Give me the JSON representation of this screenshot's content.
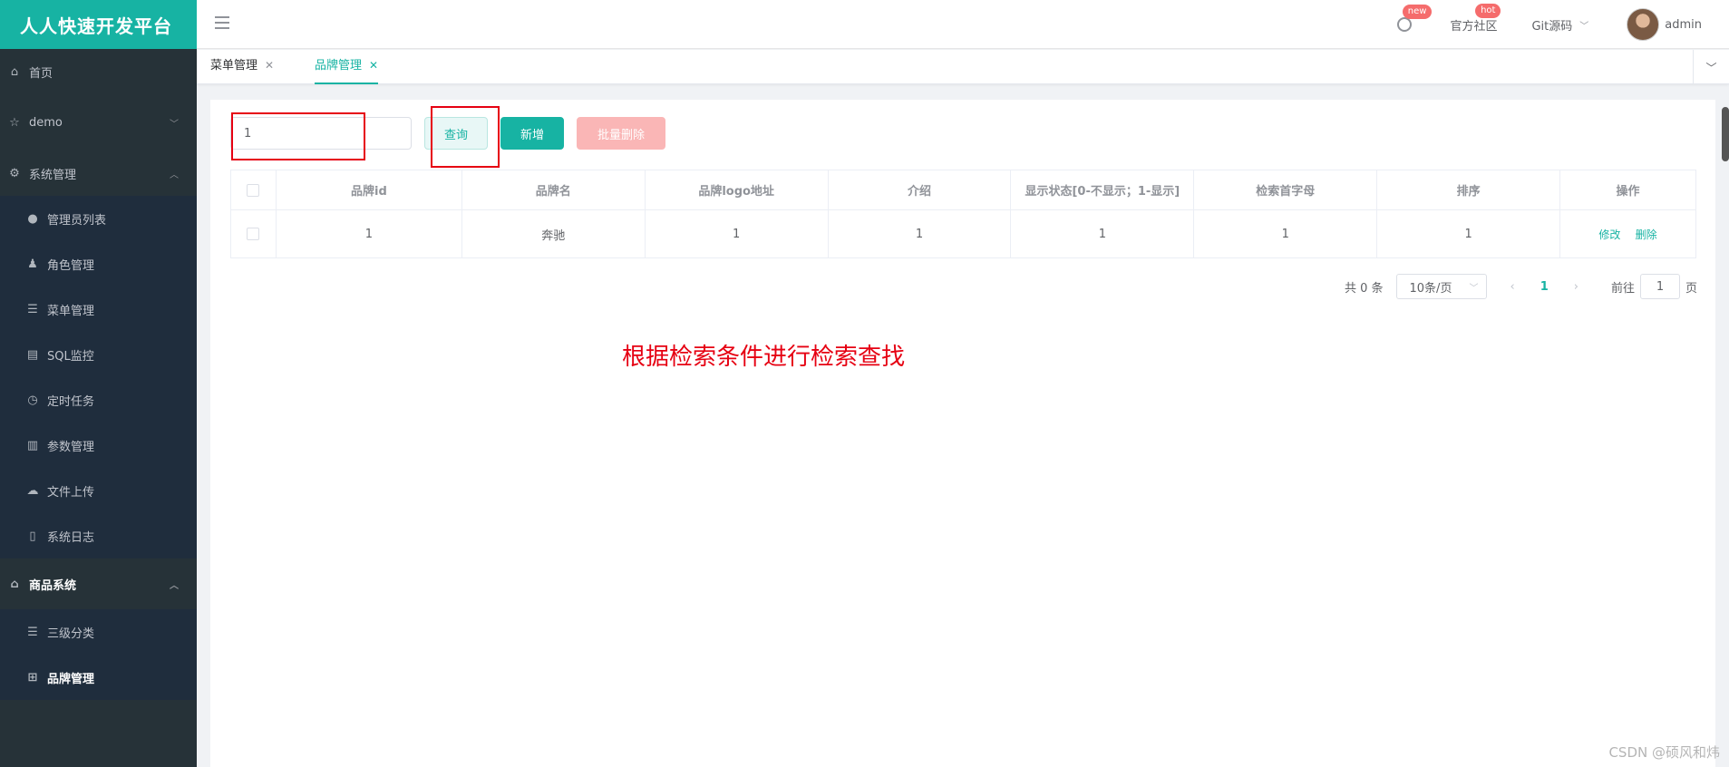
{
  "sidebar": {
    "brand": "人人快速开发平台",
    "items": [
      {
        "label": "首页",
        "icon": "home-icon"
      },
      {
        "label": "demo",
        "icon": "star-icon"
      },
      {
        "label": "系统管理",
        "icon": "gear-icon"
      },
      {
        "label": "管理员列表",
        "icon": "user-icon"
      },
      {
        "label": "角色管理",
        "icon": "role-icon"
      },
      {
        "label": "菜单管理",
        "icon": "list-icon"
      },
      {
        "label": "SQL监控",
        "icon": "monitor-icon"
      },
      {
        "label": "定时任务",
        "icon": "clock-icon"
      },
      {
        "label": "参数管理",
        "icon": "document-icon"
      },
      {
        "label": "文件上传",
        "icon": "cloud-upload-icon"
      },
      {
        "label": "系统日志",
        "icon": "log-icon"
      },
      {
        "label": "商品系统",
        "icon": "home-icon"
      },
      {
        "label": "三级分类",
        "icon": "list-icon"
      },
      {
        "label": "品牌管理",
        "icon": "grid-icon"
      }
    ]
  },
  "header": {
    "badge_new": "new",
    "community": "官方社区",
    "badge_hot": "hot",
    "git": "Git源码",
    "username": "admin"
  },
  "tabs": [
    {
      "label": "菜单管理"
    },
    {
      "label": "品牌管理"
    }
  ],
  "toolbar": {
    "search_value": "1",
    "query_label": "查询",
    "add_label": "新增",
    "batch_delete_label": "批量删除"
  },
  "table": {
    "columns": [
      "品牌id",
      "品牌名",
      "品牌logo地址",
      "介绍",
      "显示状态[0-不显示；1-显示]",
      "检索首字母",
      "排序",
      "操作"
    ],
    "rows": [
      {
        "cells": [
          "1",
          "奔驰",
          "1",
          "1",
          "1",
          "1",
          "1"
        ],
        "edit": "修改",
        "delete": "删除"
      }
    ]
  },
  "pagination": {
    "total": "共 0 条",
    "page_size": "10条/页",
    "current": "1",
    "goto_label": "前往",
    "goto_value": "1",
    "page_suffix": "页"
  },
  "annotation": "根据检索条件进行检索查找",
  "watermark": "CSDN @硕风和炜",
  "colors": {
    "accent": "#17b3a3",
    "sidebar": "#263238",
    "annotation": "#e60012",
    "danger_light": "#fab6b6"
  }
}
